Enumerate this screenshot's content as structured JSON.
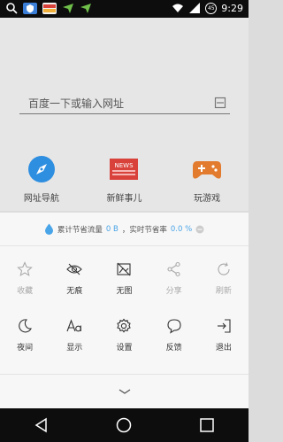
{
  "status_bar": {
    "time": "9:29",
    "battery_level": "45",
    "notification_icons": [
      "search-icon",
      "shield-icon",
      "lottery-icon",
      "send-icon",
      "send-icon"
    ]
  },
  "browser": {
    "search_placeholder": "百度一下或输入网址",
    "shortcuts": [
      {
        "label": "网址导航",
        "icon": "compass-icon"
      },
      {
        "label": "新鲜事儿",
        "icon": "news-icon",
        "badge": "NEWS"
      },
      {
        "label": "玩游戏",
        "icon": "gamepad-icon"
      }
    ]
  },
  "data_saving": {
    "prefix": "累计节省流量",
    "saved": "0 B",
    "middle": "，实时节省率",
    "rate": "0.0 %"
  },
  "menu": {
    "row1": [
      {
        "label": "收藏",
        "icon": "star-icon",
        "enabled": false
      },
      {
        "label": "无痕",
        "icon": "incognito-eye-icon",
        "enabled": true
      },
      {
        "label": "无图",
        "icon": "no-image-icon",
        "enabled": true
      },
      {
        "label": "分享",
        "icon": "share-icon",
        "enabled": false
      },
      {
        "label": "刷新",
        "icon": "refresh-icon",
        "enabled": false
      }
    ],
    "row2": [
      {
        "label": "夜间",
        "icon": "moon-icon",
        "enabled": true
      },
      {
        "label": "显示",
        "icon": "font-icon",
        "enabled": true
      },
      {
        "label": "设置",
        "icon": "gear-icon",
        "enabled": true
      },
      {
        "label": "反馈",
        "icon": "feedback-icon",
        "enabled": true
      },
      {
        "label": "退出",
        "icon": "exit-icon",
        "enabled": true
      }
    ]
  },
  "colors": {
    "accent": "#4aa5e8",
    "news_red": "#d9423b",
    "game_orange": "#e27b2e"
  }
}
